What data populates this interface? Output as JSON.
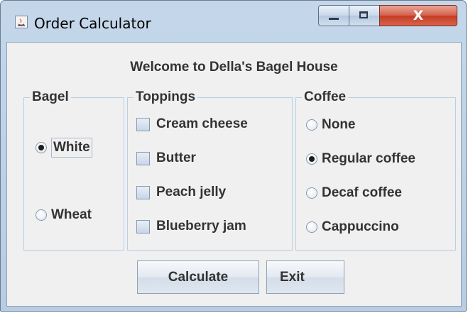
{
  "window": {
    "title": "Order Calculator",
    "icon": "java-icon",
    "controls": {
      "minimize_icon": "minimize-icon",
      "maximize_icon": "maximize-icon",
      "close_glyph": "X"
    }
  },
  "heading": "Welcome to Della's Bagel House",
  "bagel": {
    "title": "Bagel",
    "options": [
      {
        "label": "White",
        "selected": true
      },
      {
        "label": "Wheat",
        "selected": false
      }
    ]
  },
  "toppings": {
    "title": "Toppings",
    "options": [
      {
        "label": "Cream cheese",
        "checked": false
      },
      {
        "label": "Butter",
        "checked": false
      },
      {
        "label": "Peach jelly",
        "checked": false
      },
      {
        "label": "Blueberry jam",
        "checked": false
      }
    ]
  },
  "coffee": {
    "title": "Coffee",
    "options": [
      {
        "label": "None",
        "selected": false
      },
      {
        "label": "Regular coffee",
        "selected": true
      },
      {
        "label": "Decaf coffee",
        "selected": false
      },
      {
        "label": "Cappuccino",
        "selected": false
      }
    ]
  },
  "buttons": {
    "calculate": "Calculate",
    "exit": "Exit"
  },
  "colors": {
    "titlebar": "#b7cde4",
    "close_button": "#c43b22",
    "panel": "#f0f0f0",
    "group_border": "#b8cfe4"
  }
}
